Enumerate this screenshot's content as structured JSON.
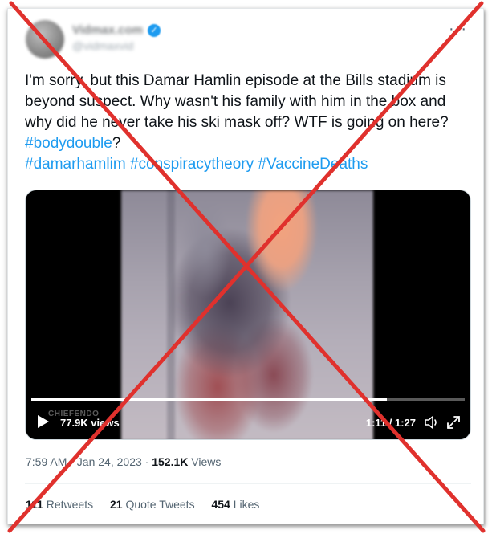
{
  "author": {
    "display_name": "Vidmax.com",
    "handle": "@vidmaxvid"
  },
  "tweet": {
    "text_prefix": "I'm sorry, but this Damar Hamlin episode at the Bills stadium is beyond suspect. Why wasn't his family with him in the box and why did he never take his ski mask off? WTF is going on here? ",
    "hashtags": [
      "#bodydouble",
      "#damarhamlim",
      "#conspiracytheory",
      "#VaccineDeaths"
    ],
    "after_first_hashtag": "?"
  },
  "video": {
    "views": "77.9K views",
    "time": "1:11 / 1:27",
    "watermark": "CHIEFENDO",
    "progress": 0.82
  },
  "meta": {
    "timestamp": "7:59 AM · Jan 24, 2023 · ",
    "views_count": "152.1K",
    "views_label": " Views"
  },
  "stats": {
    "retweets_count": "111",
    "retweets_label": "Retweets",
    "quotes_count": "21",
    "quotes_label": "Quote Tweets",
    "likes_count": "454",
    "likes_label": "Likes"
  },
  "icons": {
    "more": "more-horizontal-icon",
    "verified": "verified-badge-icon",
    "play": "play-icon",
    "volume": "volume-icon",
    "expand": "expand-icon"
  },
  "colors": {
    "hashtag": "#1d9bf0",
    "cross": "#e0312d"
  }
}
